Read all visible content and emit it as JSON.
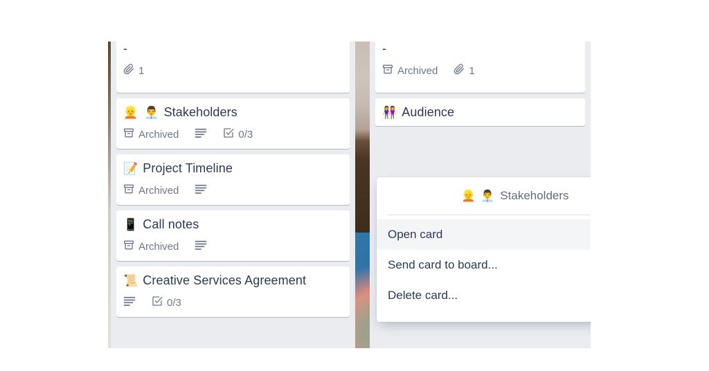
{
  "board": {
    "background_color": "#ebecf0",
    "photo_description": "washi tape rolls on blue background"
  },
  "lists": [
    {
      "name": "left-list",
      "cards": [
        {
          "title": "-",
          "emojis": [],
          "clipped": true,
          "badges": [
            {
              "icon": "attachment-icon",
              "label": "1"
            }
          ]
        },
        {
          "title": "Stakeholders",
          "emojis": [
            "👱",
            "👨‍💼"
          ],
          "clipped": false,
          "badges": [
            {
              "icon": "archive-icon",
              "label": "Archived"
            },
            {
              "icon": "description-icon",
              "label": ""
            },
            {
              "icon": "checklist-icon",
              "label": "0/3"
            }
          ]
        },
        {
          "title": "Project Timeline",
          "emojis": [
            "📝"
          ],
          "clipped": false,
          "badges": [
            {
              "icon": "archive-icon",
              "label": "Archived"
            },
            {
              "icon": "description-icon",
              "label": ""
            }
          ]
        },
        {
          "title": "Call notes",
          "emojis": [
            "📱"
          ],
          "clipped": false,
          "badges": [
            {
              "icon": "archive-icon",
              "label": "Archived"
            },
            {
              "icon": "description-icon",
              "label": ""
            }
          ]
        },
        {
          "title": "Creative Services Agreement",
          "emojis": [
            "📜"
          ],
          "clipped": false,
          "badges": [
            {
              "icon": "description-icon",
              "label": ""
            },
            {
              "icon": "checklist-icon",
              "label": "0/3"
            }
          ]
        }
      ]
    },
    {
      "name": "right-list",
      "cards": [
        {
          "title": "-",
          "emojis": [],
          "clipped": true,
          "badges": [
            {
              "icon": "archive-icon",
              "label": "Archived"
            },
            {
              "icon": "attachment-icon",
              "label": "1"
            }
          ]
        },
        {
          "title": "Audience",
          "emojis": [
            "👭"
          ],
          "clipped": false,
          "badges": []
        }
      ]
    }
  ],
  "popup": {
    "title": "Stakeholders",
    "emojis": [
      "👱",
      "👨‍💼"
    ],
    "close_label": "×",
    "items": [
      {
        "label": "Open card",
        "active": true
      },
      {
        "label": "Send card to board...",
        "active": false
      },
      {
        "label": "Delete card...",
        "active": false
      }
    ]
  }
}
